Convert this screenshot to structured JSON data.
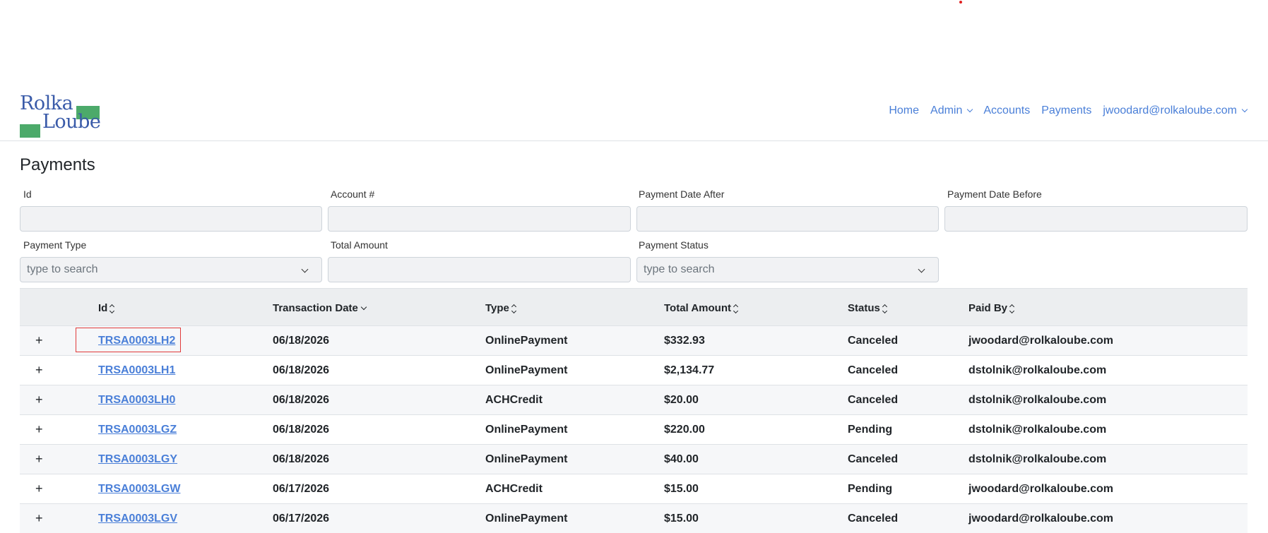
{
  "brand": {
    "line1": "Rolka",
    "line2": "Loube",
    "accent": "#4caa6a",
    "text_color": "#3a5ba9"
  },
  "nav": {
    "home": "Home",
    "admin": "Admin",
    "accounts": "Accounts",
    "payments": "Payments",
    "user": "jwoodard@rolkaloube.com"
  },
  "page": {
    "title": "Payments"
  },
  "filters": {
    "id_label": "Id",
    "account_label": "Account #",
    "date_after_label": "Payment Date After",
    "date_before_label": "Payment Date Before",
    "type_label": "Payment Type",
    "type_placeholder": "type to search",
    "total_label": "Total Amount",
    "status_label": "Payment Status",
    "status_placeholder": "type to search"
  },
  "table": {
    "columns": {
      "id": "Id",
      "date": "Transaction Date",
      "type": "Type",
      "amount": "Total Amount",
      "status": "Status",
      "paid_by": "Paid By"
    },
    "expand_symbol": "+",
    "rows": [
      {
        "id": "TRSA0003LH2",
        "date": "06/18/2026",
        "type": "OnlinePayment",
        "amount": "$332.93",
        "status": "Canceled",
        "paid_by": "jwoodard@rolkaloube.com"
      },
      {
        "id": "TRSA0003LH1",
        "date": "06/18/2026",
        "type": "OnlinePayment",
        "amount": "$2,134.77",
        "status": "Canceled",
        "paid_by": "dstolnik@rolkaloube.com"
      },
      {
        "id": "TRSA0003LH0",
        "date": "06/18/2026",
        "type": "ACHCredit",
        "amount": "$20.00",
        "status": "Canceled",
        "paid_by": "dstolnik@rolkaloube.com"
      },
      {
        "id": "TRSA0003LGZ",
        "date": "06/18/2026",
        "type": "OnlinePayment",
        "amount": "$220.00",
        "status": "Pending",
        "paid_by": "dstolnik@rolkaloube.com"
      },
      {
        "id": "TRSA0003LGY",
        "date": "06/18/2026",
        "type": "OnlinePayment",
        "amount": "$40.00",
        "status": "Canceled",
        "paid_by": "dstolnik@rolkaloube.com"
      },
      {
        "id": "TRSA0003LGW",
        "date": "06/17/2026",
        "type": "ACHCredit",
        "amount": "$15.00",
        "status": "Pending",
        "paid_by": "jwoodard@rolkaloube.com"
      },
      {
        "id": "TRSA0003LGV",
        "date": "06/17/2026",
        "type": "OnlinePayment",
        "amount": "$15.00",
        "status": "Canceled",
        "paid_by": "jwoodard@rolkaloube.com"
      }
    ]
  }
}
